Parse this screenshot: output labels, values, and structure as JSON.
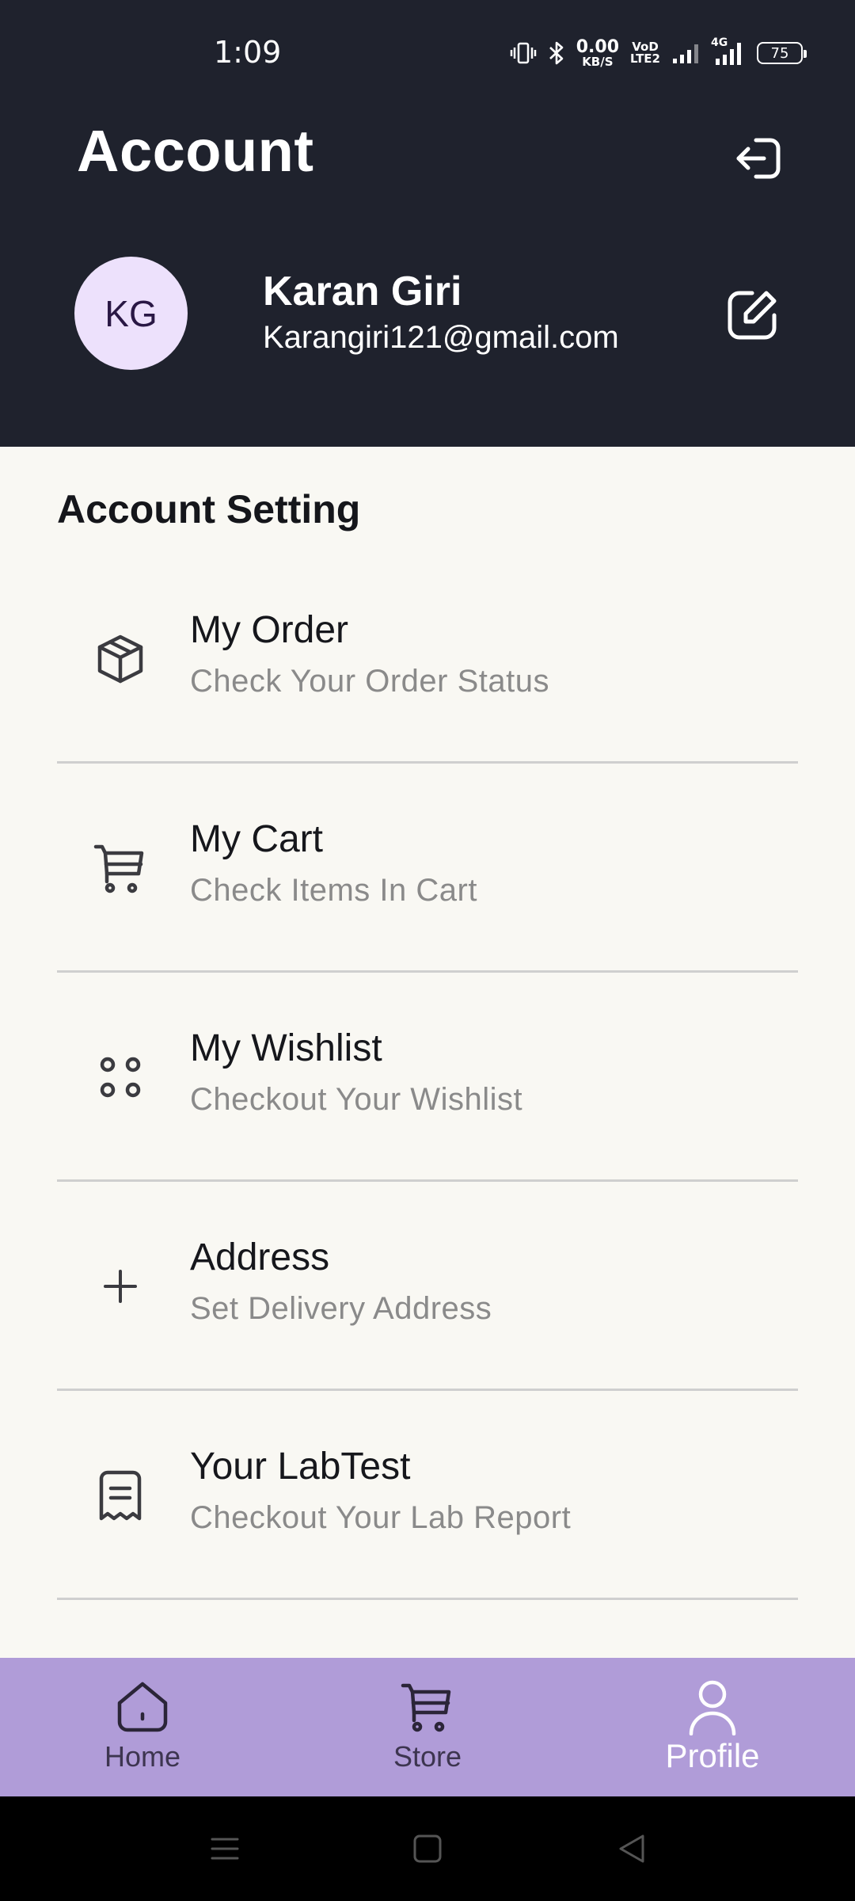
{
  "status_bar": {
    "time": "1:09",
    "net_speed_value": "0.00",
    "net_speed_unit": "KB/S",
    "volte_top": "VoD",
    "volte_bottom": "LTE2",
    "network_type": "4G",
    "battery": "75"
  },
  "header": {
    "title": "Account",
    "user": {
      "initials": "KG",
      "name": "Karan Giri",
      "email": "Karangiri121@gmail.com"
    }
  },
  "settings": {
    "section_title": "Account Setting",
    "items": [
      {
        "title": "My Order",
        "subtitle": "Check Your Order Status",
        "icon": "package-icon"
      },
      {
        "title": "My Cart",
        "subtitle": "Check Items In Cart",
        "icon": "cart-icon"
      },
      {
        "title": "My Wishlist",
        "subtitle": "Checkout Your Wishlist",
        "icon": "four-dots-icon"
      },
      {
        "title": "Address",
        "subtitle": "Set Delivery Address",
        "icon": "plus-icon"
      },
      {
        "title": "Your LabTest",
        "subtitle": "Checkout Your Lab Report",
        "icon": "receipt-icon"
      }
    ]
  },
  "bottom_nav": {
    "items": [
      {
        "label": "Home",
        "icon": "home-icon"
      },
      {
        "label": "Store",
        "icon": "cart-icon"
      },
      {
        "label": "Profile",
        "icon": "person-icon",
        "active": true
      }
    ]
  },
  "colors": {
    "header_bg": "#1f222d",
    "page_bg": "#f9f8f3",
    "avatar_bg": "#ede1fc",
    "nav_bg": "#b09cd8",
    "divider": "#cfcfcf"
  }
}
